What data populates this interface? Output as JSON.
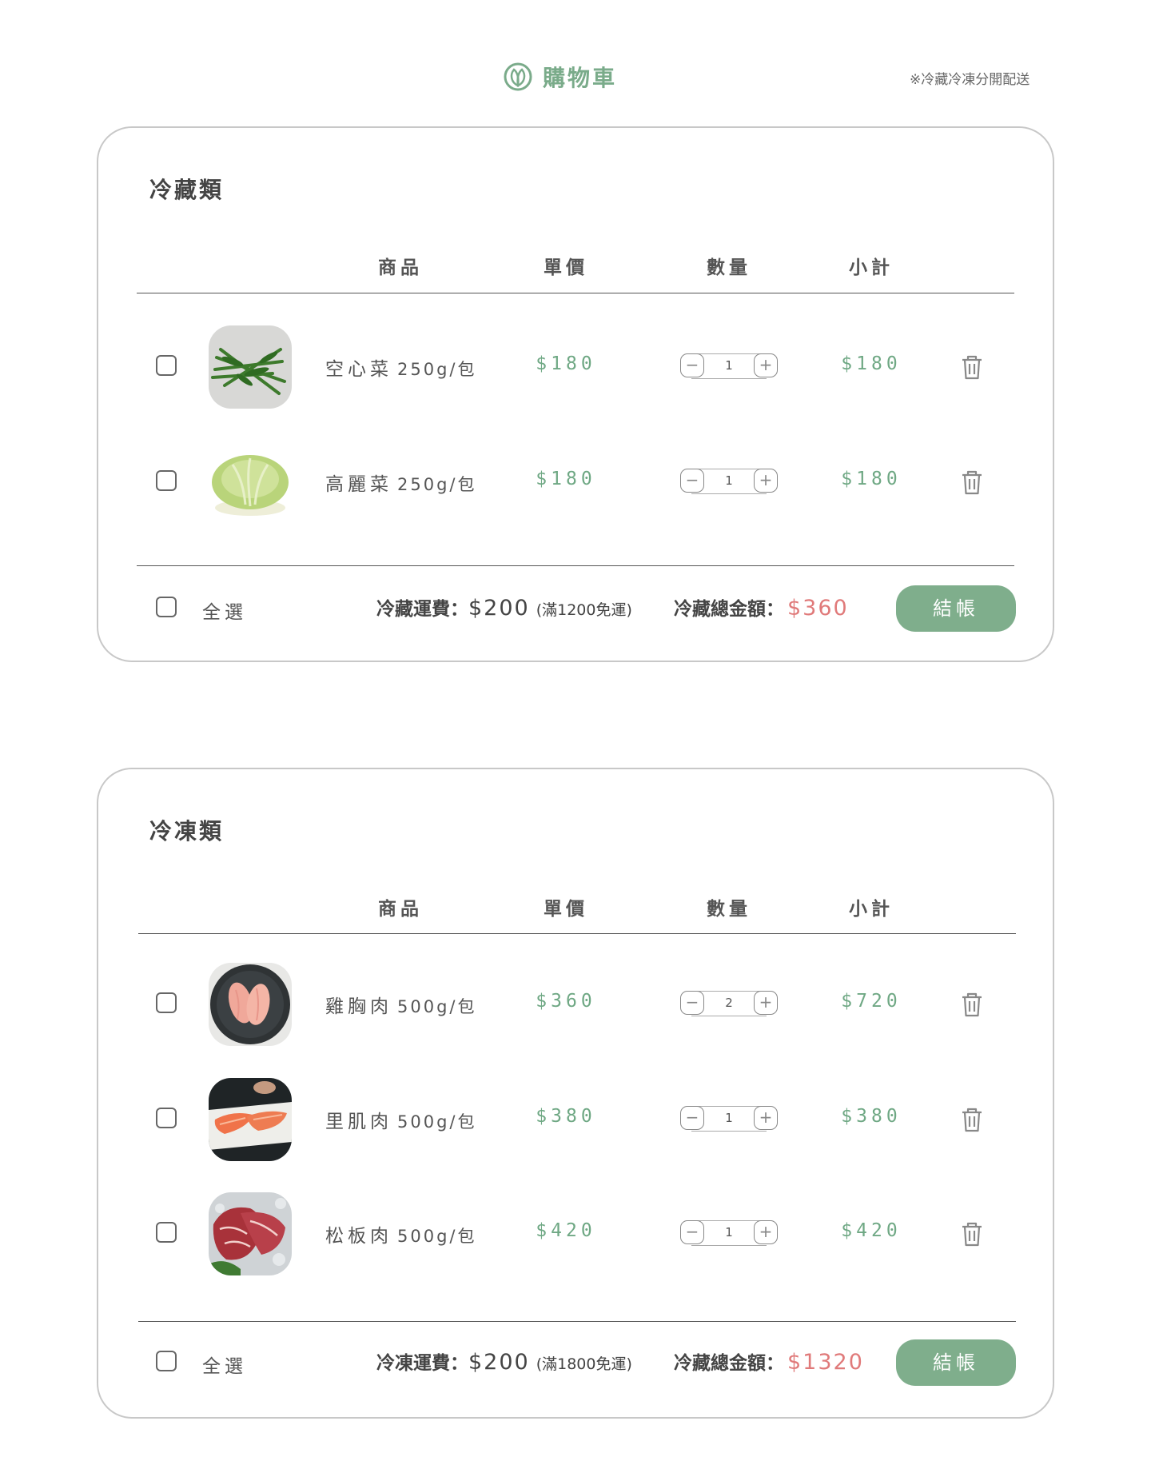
{
  "header": {
    "title": "購物車",
    "notice": "※冷藏冷凍分開配送"
  },
  "columns": {
    "product": "商品",
    "unit_price": "單價",
    "quantity": "數量",
    "subtotal": "小計"
  },
  "chilled": {
    "title": "冷藏類",
    "items": [
      {
        "name": "空心菜",
        "size": "250g/包",
        "price": "$180",
        "qty": "1",
        "subtotal": "$180"
      },
      {
        "name": "高麗菜",
        "size": "250g/包",
        "price": "$180",
        "qty": "1",
        "subtotal": "$180"
      }
    ],
    "footer": {
      "select_all": "全選",
      "shipping_label": "冷藏運費：",
      "shipping_amount": "$200",
      "shipping_note": "(滿1200免運)",
      "total_label": "冷藏總金額：",
      "total_amount": "$360",
      "checkout": "結帳"
    }
  },
  "frozen": {
    "title": "冷凍類",
    "items": [
      {
        "name": "雞胸肉",
        "size": "500g/包",
        "price": "$360",
        "qty": "2",
        "subtotal": "$720"
      },
      {
        "name": "里肌肉",
        "size": "500g/包",
        "price": "$380",
        "qty": "1",
        "subtotal": "$380"
      },
      {
        "name": "松板肉",
        "size": "500g/包",
        "price": "$420",
        "qty": "1",
        "subtotal": "$420"
      }
    ],
    "footer": {
      "select_all": "全選",
      "shipping_label": "冷凍運費：",
      "shipping_amount": "$200",
      "shipping_note": "(滿1800免運)",
      "total_label": "冷藏總金額：",
      "total_amount": "$1320",
      "checkout": "結帳"
    }
  },
  "colors": {
    "brand": "#7aab8a",
    "price": "#6fa884",
    "total": "#e07a7a",
    "button": "#7fae8c"
  }
}
